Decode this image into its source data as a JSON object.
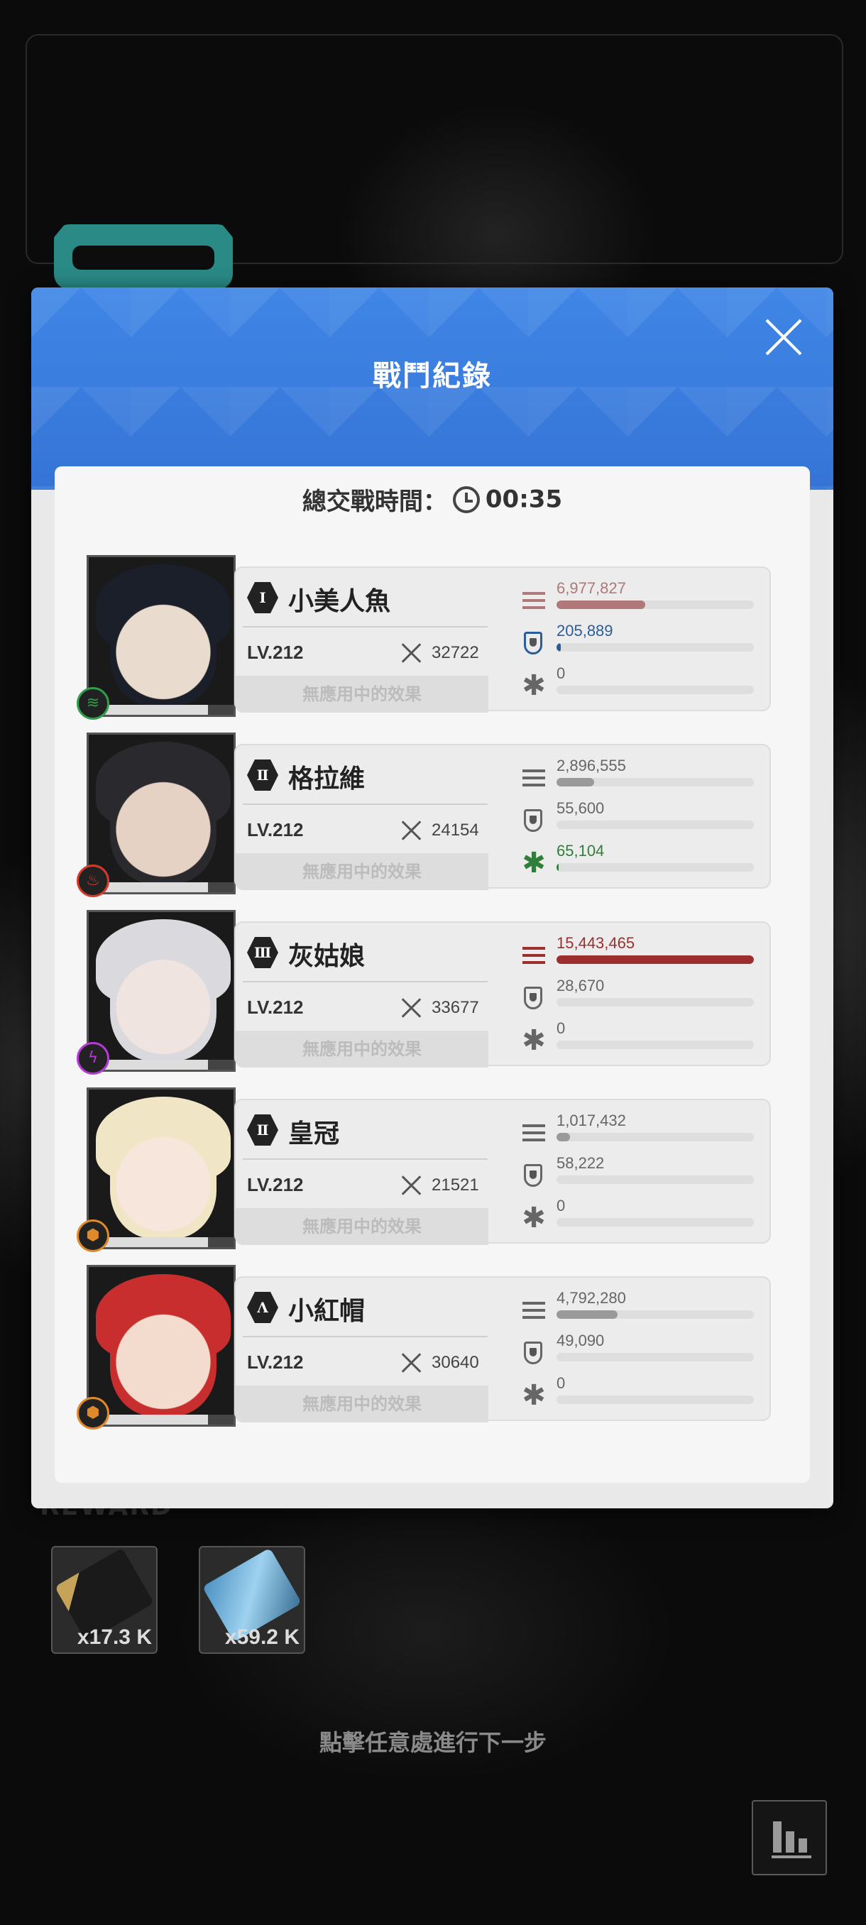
{
  "dialog": {
    "title": "戰鬥紀錄",
    "battle_time_label": "總交戰時間：",
    "battle_time": "00:35"
  },
  "characters": [
    {
      "rank": "Ⅰ",
      "name": "小美人魚",
      "level": "LV.212",
      "power": "32722",
      "effect": "無應用中的效果",
      "element_icon": "wind-icon",
      "element_color": "#2e9e4a",
      "damage": "6,977,827",
      "damage_ratio": 0.45,
      "shield": "205,889",
      "shield_ratio": 0.02,
      "heal": "0",
      "heal_ratio": 0
    },
    {
      "rank": "Ⅱ",
      "name": "格拉維",
      "level": "LV.212",
      "power": "24154",
      "effect": "無應用中的效果",
      "element_icon": "fire-icon",
      "element_color": "#d23b2a",
      "damage": "2,896,555",
      "damage_ratio": 0.19,
      "shield": "55,600",
      "shield_ratio": 0,
      "heal": "65,104",
      "heal_ratio": 0.01
    },
    {
      "rank": "Ⅲ",
      "name": "灰姑娘",
      "level": "LV.212",
      "power": "33677",
      "effect": "無應用中的效果",
      "element_icon": "electric-icon",
      "element_color": "#b43ad6",
      "damage": "15,443,465",
      "damage_ratio": 1.0,
      "shield": "28,670",
      "shield_ratio": 0,
      "heal": "0",
      "heal_ratio": 0
    },
    {
      "rank": "Ⅱ",
      "name": "皇冠",
      "level": "LV.212",
      "power": "21521",
      "effect": "無應用中的效果",
      "element_icon": "iron-icon",
      "element_color": "#e0892a",
      "damage": "1,017,432",
      "damage_ratio": 0.07,
      "shield": "58,222",
      "shield_ratio": 0,
      "heal": "0",
      "heal_ratio": 0
    },
    {
      "rank": "Λ",
      "name": "小紅帽",
      "level": "LV.212",
      "power": "30640",
      "effect": "無應用中的效果",
      "element_icon": "iron-icon",
      "element_color": "#e0892a",
      "damage": "4,792,280",
      "damage_ratio": 0.31,
      "shield": "49,090",
      "shield_ratio": 0,
      "heal": "0",
      "heal_ratio": 0
    }
  ],
  "rewards": {
    "label": "REWARD",
    "items": [
      {
        "name": "credit-card-item",
        "quantity": "x17.3 K"
      },
      {
        "name": "core-dust-item",
        "quantity": "x59.2 K"
      }
    ]
  },
  "continue_hint": "點擊任意處進行下一步",
  "colors": {
    "header_blue": "#3a7ee0",
    "damage_top": "#9b2f2f",
    "damage_mid": "#b07878",
    "shield_blue": "#2b5d99",
    "heal_green": "#2f7f3a"
  }
}
